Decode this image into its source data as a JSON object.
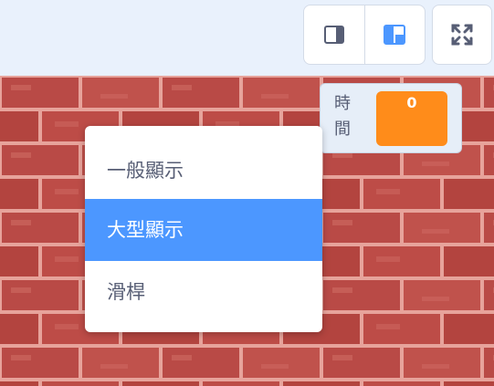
{
  "toolbar": {
    "small_stage_button": {
      "icon": "small-stage-icon"
    },
    "normal_stage_button": {
      "icon": "normal-stage-icon",
      "active_color": "#4c97ff"
    },
    "fullscreen_button": {
      "icon": "fullscreen-icon"
    }
  },
  "stage": {
    "backdrop": "brick-wall",
    "brick_color": "#b94a46",
    "mortar_color": "#e7a39b"
  },
  "monitor": {
    "label": "時間",
    "value": "0",
    "value_color": "#ff8c1a"
  },
  "context_menu": {
    "items": [
      {
        "label": "一般顯示",
        "selected": false
      },
      {
        "label": "大型顯示",
        "selected": true
      },
      {
        "label": "滑桿",
        "selected": false
      }
    ],
    "highlight_color": "#4c97ff"
  }
}
